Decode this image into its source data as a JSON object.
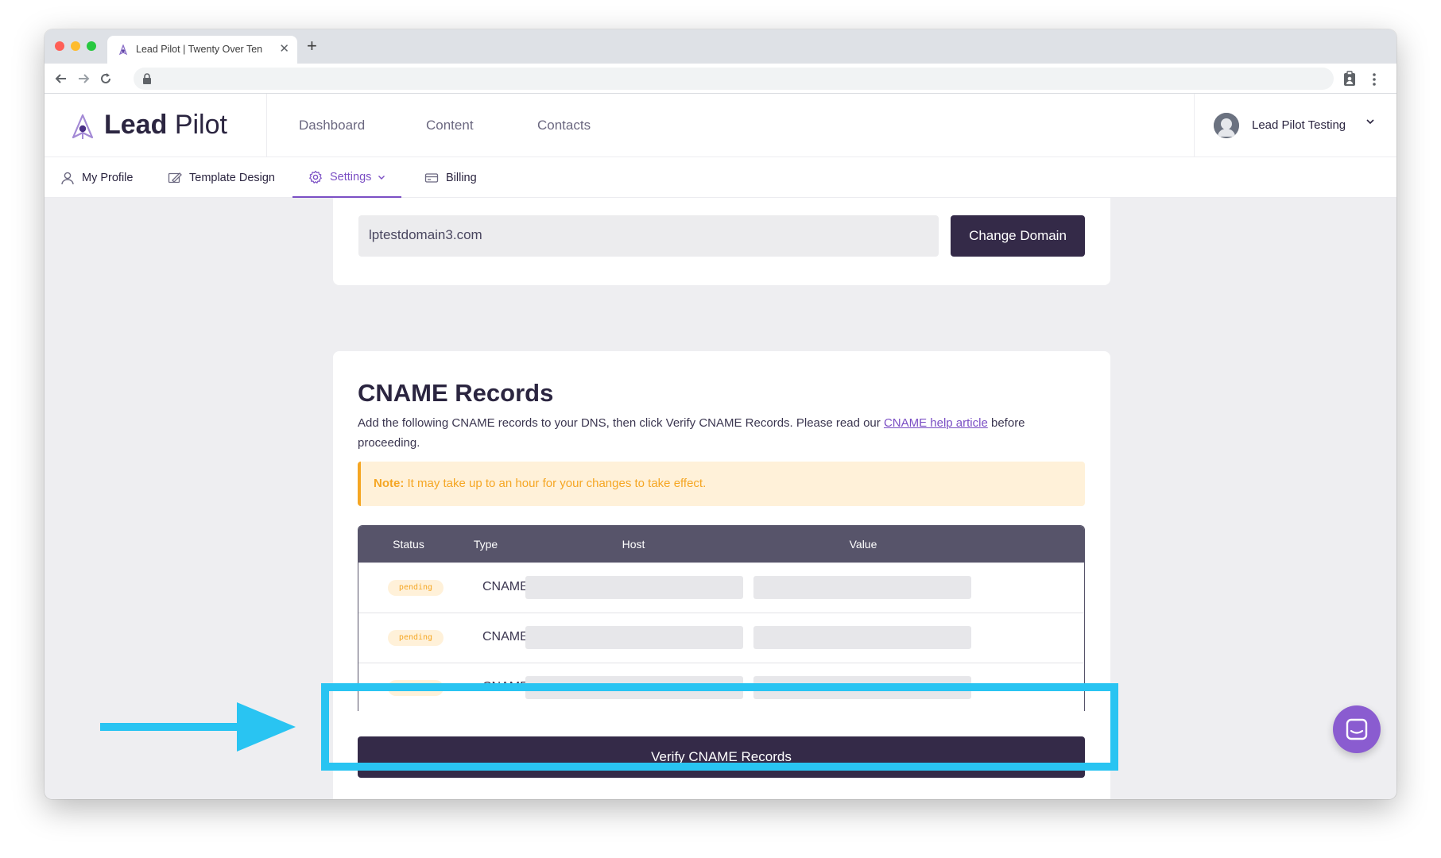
{
  "browser": {
    "tab_title": "Lead Pilot | Twenty Over Ten",
    "close_glyph": "✕",
    "new_tab_glyph": "+",
    "url": ""
  },
  "app": {
    "brand": {
      "name_bold": "Lead",
      "name_light": "Pilot"
    },
    "topnav": [
      "Dashboard",
      "Content",
      "Contacts"
    ],
    "user": {
      "name": "Lead Pilot Testing"
    },
    "subnav": {
      "my_profile": "My Profile",
      "template_design": "Template Design",
      "settings": "Settings",
      "billing": "Billing"
    }
  },
  "domain": {
    "value": "lptestdomain3.com",
    "change_button": "Change Domain"
  },
  "cname": {
    "title": "CNAME Records",
    "desc_before": "Add the following CNAME records to your DNS, then click Verify CNAME Records. Please read our ",
    "desc_link": "CNAME help article",
    "desc_after": " before proceeding.",
    "note_label": "Note:",
    "note_text": " It may take up to an hour for your changes to take effect.",
    "columns": [
      "Status",
      "Type",
      "Host",
      "Value"
    ],
    "rows": [
      {
        "status": "pending",
        "type": "CNAME"
      },
      {
        "status": "pending",
        "type": "CNAME"
      },
      {
        "status": "pending",
        "type": "CNAME"
      }
    ],
    "verify_button": "Verify CNAME Records"
  },
  "colors": {
    "accent_purple": "#7b4fc4",
    "button_dark": "#342a48",
    "pending": "#f5a623",
    "annotation_blue": "#29c4f2"
  }
}
